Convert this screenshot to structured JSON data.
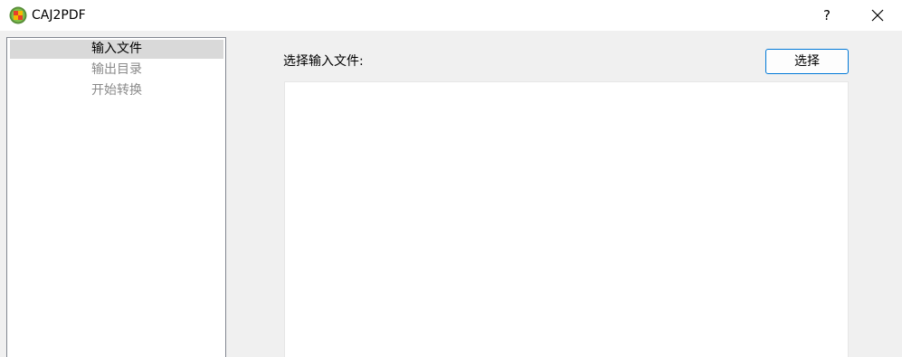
{
  "window": {
    "title": "CAJ2PDF",
    "help_label": "?",
    "icons": {
      "app": "app-logo-icon",
      "close": "close-icon"
    }
  },
  "nav": {
    "items": [
      {
        "label": "输入文件",
        "selected": true
      },
      {
        "label": "输出目录",
        "selected": false
      },
      {
        "label": "开始转换",
        "selected": false
      }
    ]
  },
  "main": {
    "field_label": "选择输入文件:",
    "select_button_label": "选择",
    "file_list_items": []
  },
  "colors": {
    "button_border": "#0078d7",
    "selected_item_bg": "#d9d9d9",
    "disabled_text": "#8a8a8a"
  }
}
